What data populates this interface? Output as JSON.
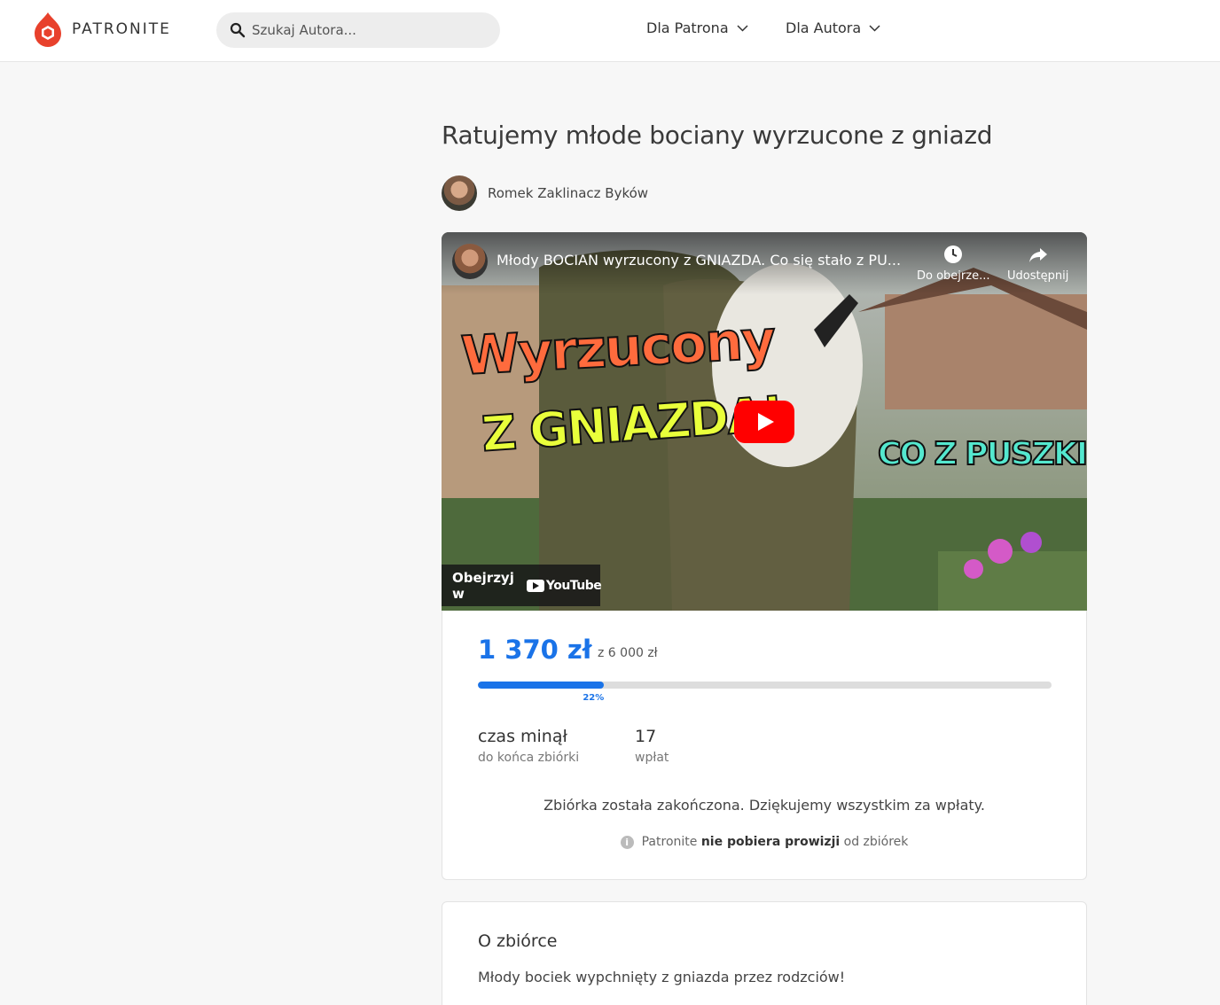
{
  "header": {
    "logo_text": "PATRONITE",
    "brand_color": "#e8412c",
    "search_placeholder": "Szukaj Autora...",
    "nav": [
      {
        "label": "Dla Patrona"
      },
      {
        "label": "Dla Autora"
      }
    ]
  },
  "campaign": {
    "title": "Ratujemy młode bociany wyrzucone z gniazd",
    "author_name": "Romek Zaklinacz Byków"
  },
  "video": {
    "title": "Młody BOCIAN wyrzucony z GNIAZDA. Co się stało z PU...",
    "watch_later_label": "Do obejrze...",
    "share_label": "Udostępnij",
    "overlay_line1": "Wyrzucony",
    "overlay_line2": "Z GNIAZDA!",
    "overlay_line3": "CO Z PUSZKIEM?",
    "watch_on_label": "Obejrzyj w",
    "youtube_label": "YouTube"
  },
  "progress": {
    "raised": "1 370 zł",
    "goal": "z 6 000 zł",
    "percent_label": "22%",
    "fraction": 0.22,
    "accent_color": "#1a73e8",
    "stats": [
      {
        "value": "czas minął",
        "label": "do końca zbiórki"
      },
      {
        "value": "17",
        "label": "wpłat"
      }
    ],
    "ended_message": "Zbiórka została zakończona. Dziękujemy wszystkim za wpłaty.",
    "fee_prefix": "Patronite",
    "fee_bold": "nie pobiera prowizji",
    "fee_suffix": "od zbiórek"
  },
  "about": {
    "heading": "O zbiórce",
    "text": "Młody bociek wypchnięty z gniazda przez rodzciów!"
  }
}
